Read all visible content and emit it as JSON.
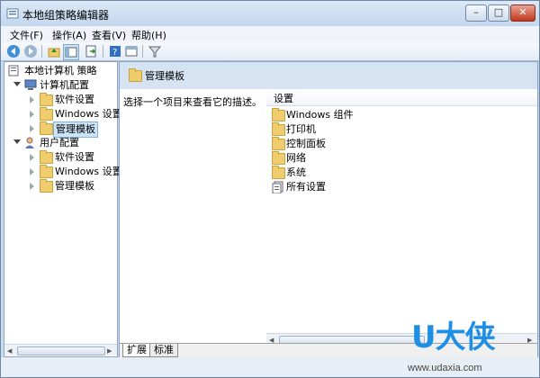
{
  "window": {
    "title": "本地组策略编辑器",
    "controls": {
      "minimize": "–",
      "maximize": "□",
      "close": "✕"
    }
  },
  "menu": [
    "文件(F)",
    "操作(A)",
    "查看(V)",
    "帮助(H)"
  ],
  "toolbar": {
    "icons": [
      "back-icon",
      "forward-icon",
      "up-folder-icon",
      "show-hide-tree-icon",
      "export-list-icon",
      "help-icon",
      "properties-icon",
      "filter-icon"
    ]
  },
  "tree": {
    "root": "本地计算机 策略",
    "computer_config": "计算机配置",
    "computer_children": [
      "软件设置",
      "Windows 设置",
      "管理模板"
    ],
    "user_config": "用户配置",
    "user_children": [
      "软件设置",
      "Windows 设置",
      "管理模板"
    ],
    "selected": "管理模板"
  },
  "right_pane": {
    "header_title": "管理模板",
    "description": "选择一个项目来查看它的描述。",
    "column_header": "设置",
    "items": [
      "Windows 组件",
      "打印机",
      "控制面板",
      "网络",
      "系统",
      "所有设置"
    ]
  },
  "tabs": [
    "扩展",
    "标准"
  ],
  "watermark": {
    "logo": "U大侠",
    "url": "www.udaxia.com"
  },
  "colors": {
    "title_bg": "#c3d7ee",
    "selection": "#cce4f7",
    "folder": "#f0cd6c",
    "watermark_blue": "#1f8fe5"
  }
}
